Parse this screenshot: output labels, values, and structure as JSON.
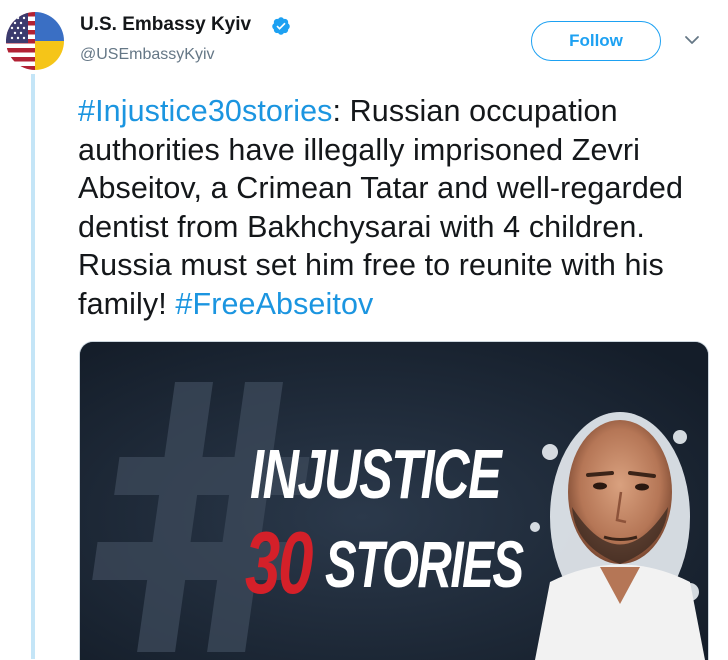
{
  "author": {
    "display_name": "U.S. Embassy Kyiv",
    "handle": "@USEmbassyKyiv",
    "verified": true,
    "avatar_icon": "us-ukraine-flag-avatar-icon"
  },
  "actions": {
    "follow_label": "Follow",
    "menu_icon": "chevron-down-icon"
  },
  "tweet": {
    "hashtag_1": "#Injustice30stories",
    "body": ": Russian occupation authorities have illegally imprisoned Zevri Abseitov, a Crimean Tatar and well-regarded dentist from Bakhchysarai with 4 children. Russia must set him free to reunite with his family! ",
    "hashtag_2": "#FreeAbseitov"
  },
  "media": {
    "line_1": "INJUSTICE",
    "line_2_number": "30",
    "line_2_word": "STORIES",
    "background_symbol": "#"
  },
  "colors": {
    "link": "#1b95e0",
    "follow": "#1da1f2",
    "thread_line": "#c4e5f7",
    "media_accent": "#d42029"
  }
}
